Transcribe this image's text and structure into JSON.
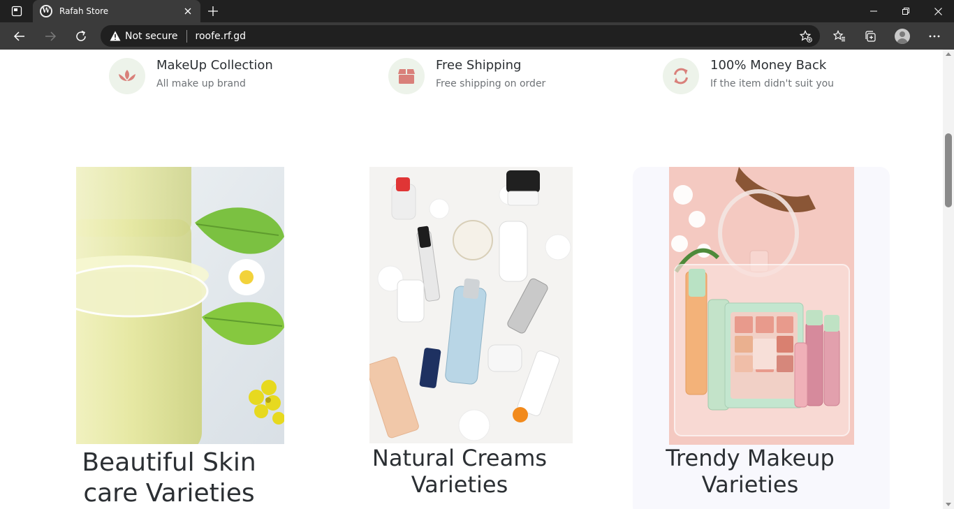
{
  "browser": {
    "tab_title": "Rafah Store",
    "security_label": "Not secure",
    "url": "roofe.rf.gd"
  },
  "features": [
    {
      "icon": "lotus-icon",
      "title": "MakeUp Collection",
      "subtitle": "All make up brand"
    },
    {
      "icon": "box-icon",
      "title": "Free Shipping",
      "subtitle": "Free shipping on order"
    },
    {
      "icon": "refresh-icon",
      "title": "100% Money Back",
      "subtitle": "If the item didn't suit you"
    }
  ],
  "products": [
    {
      "title_line1": "Beautiful Skin",
      "title_line2": "care Varieties"
    },
    {
      "title_line1": "Natural Creams",
      "title_line2": "Varieties"
    },
    {
      "title_line1": "Trendy Makeup",
      "title_line2": "Varieties"
    }
  ],
  "colors": {
    "accent": "#d9807a",
    "icon_circle": "#edf3ea",
    "heading": "#2b2f33"
  }
}
